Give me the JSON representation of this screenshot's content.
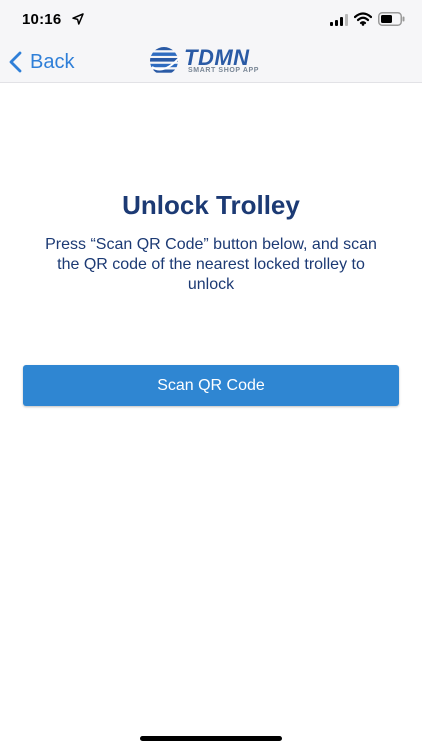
{
  "status_bar": {
    "time": "10:16"
  },
  "nav": {
    "back_label": "Back",
    "logo_text": "TDMN",
    "logo_subtitle": "SMART SHOP APP"
  },
  "main": {
    "title": "Unlock Trolley",
    "instructions": "Press “Scan QR Code” button below, and scan the QR code of the nearest locked trolley to unlock",
    "scan_button_label": "Scan QR Code"
  },
  "colors": {
    "accent": "#2f86d2",
    "title_text": "#1c3a74",
    "back_link": "#2f7fd8"
  }
}
